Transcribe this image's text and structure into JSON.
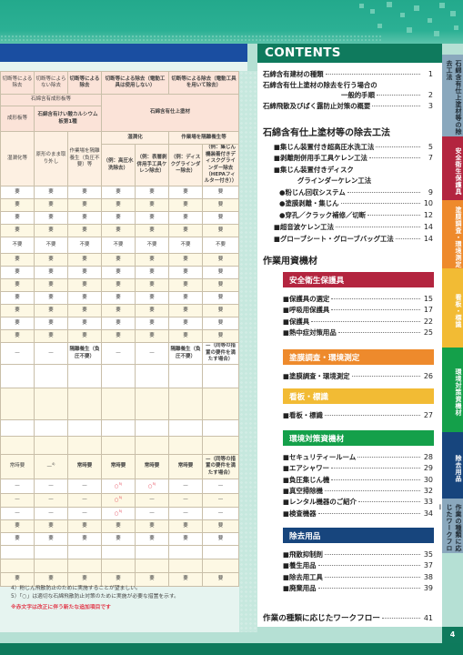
{
  "contents": {
    "title": "CONTENTS",
    "intro": [
      {
        "label": "石綿含有建材の種類",
        "page": "1"
      },
      {
        "label": "石綿含有仕上塗材の除去を行う場合の",
        "label2": "一般的手順",
        "page": "2"
      },
      {
        "label": "石綿飛散及びばく露防止対策の概要",
        "page": "3"
      }
    ],
    "removal_section": {
      "title": "石綿含有仕上塗材等の除去工法",
      "items": [
        {
          "label": "■集じん装置付き超高圧水洗工法",
          "page": "5"
        },
        {
          "label": "■剥離剤併用手工具ケレン工法",
          "page": "7"
        },
        {
          "label": "■集じん装置付きディスク",
          "label2": "グラインダーケレン工法"
        },
        {
          "label": "●粉じん回収システム",
          "page": "9"
        },
        {
          "label": "●塗膜剥離・集じん",
          "page": "10"
        },
        {
          "label": "●穿孔／クラック補修／切断",
          "page": "12"
        },
        {
          "label": "■超音波ケレン工法",
          "page": "14"
        },
        {
          "label": "■グローブシート・グローブバッグ工法",
          "page": "14"
        }
      ]
    },
    "materials_section": {
      "title": "作業用資機材",
      "categories": [
        {
          "name": "安全衛生保護具",
          "color": "#b3253f",
          "items": [
            {
              "label": "■保護具の選定",
              "page": "15"
            },
            {
              "label": "■呼吸用保護具",
              "page": "17"
            },
            {
              "label": "■保護具",
              "page": "22"
            },
            {
              "label": "■熱中症対策用品",
              "page": "25"
            }
          ]
        },
        {
          "name": "塗膜調査・環境測定",
          "color": "#ee8a2c",
          "items": [
            {
              "label": "■塗膜調査・環境測定",
              "page": "26"
            }
          ]
        },
        {
          "name": "看板・標識",
          "color": "#f2bb34",
          "items": [
            {
              "label": "■看板・標識",
              "page": "27"
            }
          ]
        },
        {
          "name": "環境対策資機材",
          "color": "#14a04a",
          "items": [
            {
              "label": "■セキュリティールーム",
              "page": "28"
            },
            {
              "label": "■エアシャワー",
              "page": "29"
            },
            {
              "label": "■負圧集じん機",
              "page": "30"
            },
            {
              "label": "■真空掃除機",
              "page": "32"
            },
            {
              "label": "■レンタル機器のご紹介",
              "page": "33"
            },
            {
              "label": "■検査機器",
              "page": "34"
            }
          ]
        },
        {
          "name": "除去用品",
          "color": "#17457d",
          "items": [
            {
              "label": "■飛散抑制剤",
              "page": "35"
            },
            {
              "label": "■養生用品",
              "page": "37"
            },
            {
              "label": "■除去用工具",
              "page": "38"
            },
            {
              "label": "■廃棄用品",
              "page": "39"
            }
          ]
        }
      ]
    },
    "workflow": {
      "label": "作業の種類に応じたワークフロー",
      "page": "41"
    }
  },
  "side_tabs": [
    {
      "label": "石綿含有仕上塗材等の除去工法",
      "color": "#8aa8bd",
      "text_color": "#1f2a33"
    },
    {
      "label": "安全衛生保護具",
      "color": "#b3253f",
      "text_color": "#ffffff"
    },
    {
      "label": "塗膜調査・環境測定",
      "color": "#ee8a2c",
      "text_color": "#ffffff"
    },
    {
      "label": "看板・標識",
      "color": "#f2bb34",
      "text_color": "#ffffff"
    },
    {
      "label": "環境対策資機材",
      "color": "#14a04a",
      "text_color": "#ffffff"
    },
    {
      "label": "除去用品",
      "color": "#17457d",
      "text_color": "#ffffff"
    },
    {
      "label": "作業の種類に応じたワークフロー",
      "color": "#8aa8bd",
      "text_color": "#1f2a33"
    }
  ],
  "page_number": "4",
  "table": {
    "header_row1": [
      "切断等による除去",
      "切断等によらない除去",
      "切断等による除去",
      "切断等による除去（電動工具は使用しない）",
      "切断等による除去（電動工具を用いて除去）"
    ],
    "header_row2": {
      "left": "石綿含有成形板等",
      "right": "石綿含有仕上塗材"
    },
    "header_row3": {
      "col1": "成形板等",
      "col2": "石綿含有けい酸カルシウム板第1種"
    },
    "header_row4": {
      "group_wet": "湿潤化",
      "group_isolate": "作業場を隔離養生等",
      "cols": [
        "湿潤化等",
        "原形のまま取り外し",
        "作業場を隔離養生（負圧不要）等",
        "（例：高圧水洗除去）",
        "（例：表層剥併用手工具ケレン除去）",
        "（例：ディスクグラインダー除去）",
        "（例：集じん機装着付きディスクグラインダー除去（HEPAフィルター付き））"
      ]
    },
    "rows": [
      [
        "要",
        "要",
        "要",
        "要",
        "要",
        "要",
        "要"
      ],
      [
        "要",
        "要",
        "要",
        "要",
        "要",
        "要",
        "要"
      ],
      [
        "要",
        "要",
        "要",
        "要",
        "要",
        "要",
        "要"
      ],
      [
        "要",
        "要",
        "要",
        "要",
        "要",
        "要",
        "要"
      ],
      [
        "不要",
        "不要",
        "不要",
        "不要",
        "不要",
        "不要",
        "不要"
      ],
      [
        "要",
        "要",
        "要",
        "要",
        "要",
        "要",
        "要"
      ],
      [
        "要",
        "要",
        "要",
        "要",
        "要",
        "要",
        "要"
      ],
      [
        "要",
        "要",
        "要",
        "要",
        "要",
        "要",
        "要"
      ],
      [
        "要",
        "要",
        "要",
        "要",
        "要",
        "要",
        "要"
      ],
      [
        "要",
        "要",
        "要",
        "要",
        "要",
        "要",
        "要"
      ],
      [
        "要",
        "要",
        "要",
        "要",
        "要",
        "要",
        "要"
      ],
      [
        "要",
        "要",
        "要",
        "要",
        "要",
        "要",
        "要"
      ],
      [
        "—",
        "—",
        "隔離養生（負圧不要）",
        "—",
        "—",
        "隔離養生（負圧不要）",
        "—（同等の措置の要件を満たす場合）"
      ],
      [
        "常時要",
        "—",
        "常時要",
        "常時要",
        "常時要",
        "常時要",
        "—（同等の措置の要件を満たす場合）"
      ],
      [
        "—",
        "—",
        "—",
        "○",
        "○",
        "—",
        "—"
      ],
      [
        "—",
        "—",
        "—",
        "○",
        "—",
        "—",
        "—"
      ],
      [
        "—",
        "—",
        "—",
        "○",
        "—",
        "—",
        "—"
      ],
      [
        "要",
        "要",
        "要",
        "要",
        "要",
        "要",
        "要"
      ],
      [
        "要",
        "要",
        "要",
        "要",
        "要",
        "要",
        "要"
      ],
      [
        "要",
        "要",
        "要",
        "要",
        "要",
        "要",
        "要"
      ]
    ],
    "sup_4": "4)",
    "sup_5": "5)"
  },
  "footnotes": [
    "4）粉じん飛散防止のために実施することが望ましい。",
    "5）「○」は適切な石綿飛散防止対策のために実施が必要な措置を示す。",
    "※赤文字は改正に伴う新たな追加項目です"
  ]
}
